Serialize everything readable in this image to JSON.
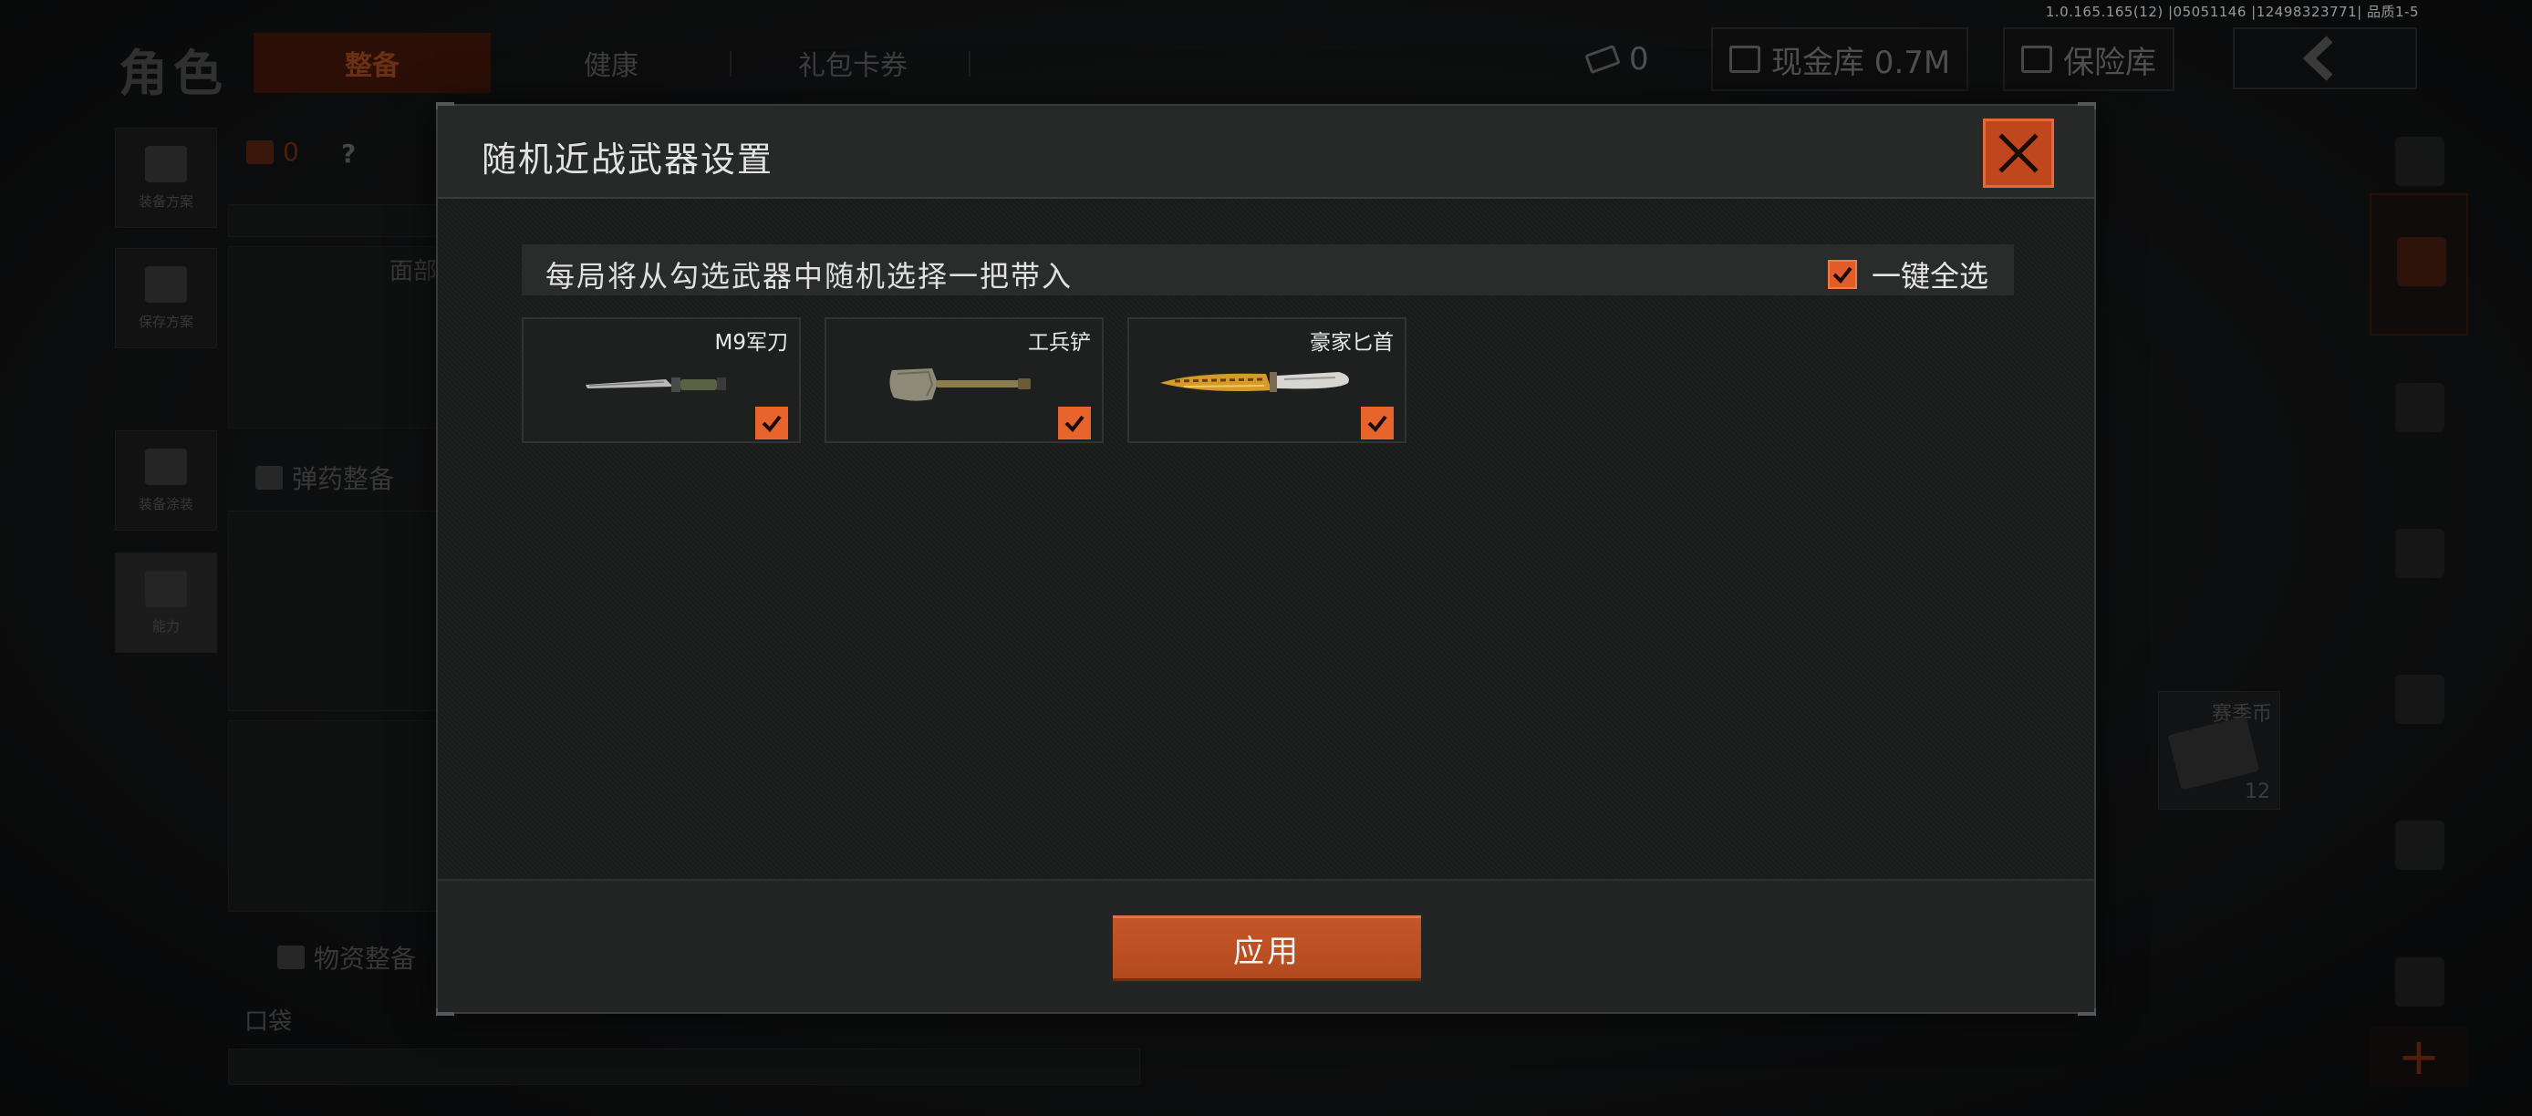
{
  "version_info": "1.0.165.165(12) |05051146 |12498323771| 品质1-5",
  "background": {
    "page_title": "角色",
    "tabs": [
      "整备",
      "健康",
      "礼包卡券"
    ],
    "currency_count": "0",
    "cash_vault": "现金库 0.7M",
    "safe_vault": "保险库",
    "helmet_count": "0",
    "help_mark": "?",
    "left_buttons": [
      "装备方案",
      "保存方案",
      "装备涂装",
      "能力"
    ],
    "face_label": "面部",
    "ammo_label": "弹药整备",
    "supply_label": "物资整备",
    "pocket_label": "口袋",
    "card_title": "赛季币",
    "card_count": "12",
    "plus_label": "+"
  },
  "modal": {
    "title": "随机近战武器设置",
    "description": "每局将从勾选武器中随机选择一把带入",
    "select_all_label": "一键全选",
    "select_all_checked": true,
    "weapons": [
      {
        "name": "M9军刀",
        "checked": true,
        "icon": "bayonet-icon"
      },
      {
        "name": "工兵铲",
        "checked": true,
        "icon": "shovel-icon"
      },
      {
        "name": "豪家匕首",
        "checked": true,
        "icon": "gold-dagger-icon"
      }
    ],
    "apply_label": "应用"
  },
  "colors": {
    "accent": "#e35d2a",
    "accent_dark": "#b34a1f",
    "modal_bg": "#1b1c1c",
    "header_bg": "#272828"
  }
}
